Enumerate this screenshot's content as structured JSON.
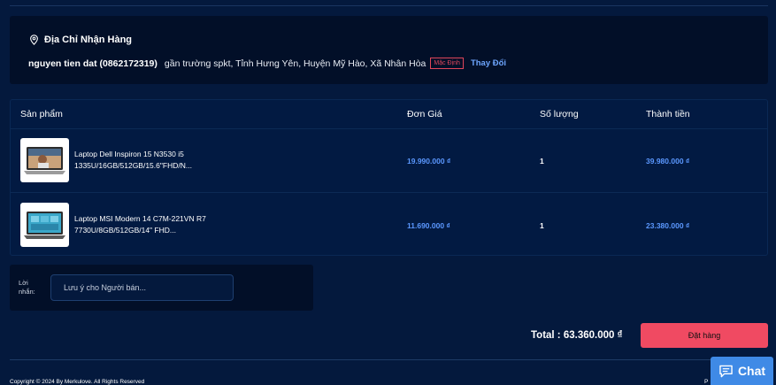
{
  "address": {
    "title": "Địa Chỉ Nhận Hàng",
    "receiver": "nguyen tien dat (0862172319)",
    "detail": "gần trường spkt,   Tỉnh Hưng Yên, Huyện Mỹ Hào, Xã Nhân Hòa",
    "default_badge": "Mặc Định",
    "change_label": "Thay Đổi"
  },
  "table": {
    "headers": {
      "product": "Sản phẩm",
      "unit_price": "Đơn Giá",
      "quantity": "Số lượng",
      "line_total": "Thành tiền"
    },
    "rows": [
      {
        "name": "Laptop Dell Inspiron 15 N3530 i5 1335U/16GB/512GB/15.6\"FHD/N...",
        "unit_price": "19.990.000 ₫",
        "quantity": "1",
        "line_total": "39.980.000 ₫"
      },
      {
        "name": "Laptop MSI Modern 14 C7M-221VN R7 7730U/8GB/512GB/14\" FHD...",
        "unit_price": "11.690.000 ₫",
        "quantity": "1",
        "line_total": "23.380.000 ₫"
      }
    ]
  },
  "note": {
    "label": "Lời nhắn:",
    "placeholder": "Lưu ý cho Người bán..."
  },
  "summary": {
    "total_text": "Total : 63.360.000 ₫",
    "order_button": "Đặt hàng"
  },
  "footer": {
    "copyright": "Copyright © 2024 By Merkulove. All Rights Reserved",
    "right_text": "P"
  },
  "chat": {
    "label": "Chat"
  },
  "colors": {
    "background": "#04193d",
    "accent_blue": "#5b98ff",
    "order_button": "#f04a62",
    "chat_button": "#3f8ae6"
  },
  "icons": {
    "location": "location-pin-icon",
    "chat": "chat-bubble-icon"
  }
}
